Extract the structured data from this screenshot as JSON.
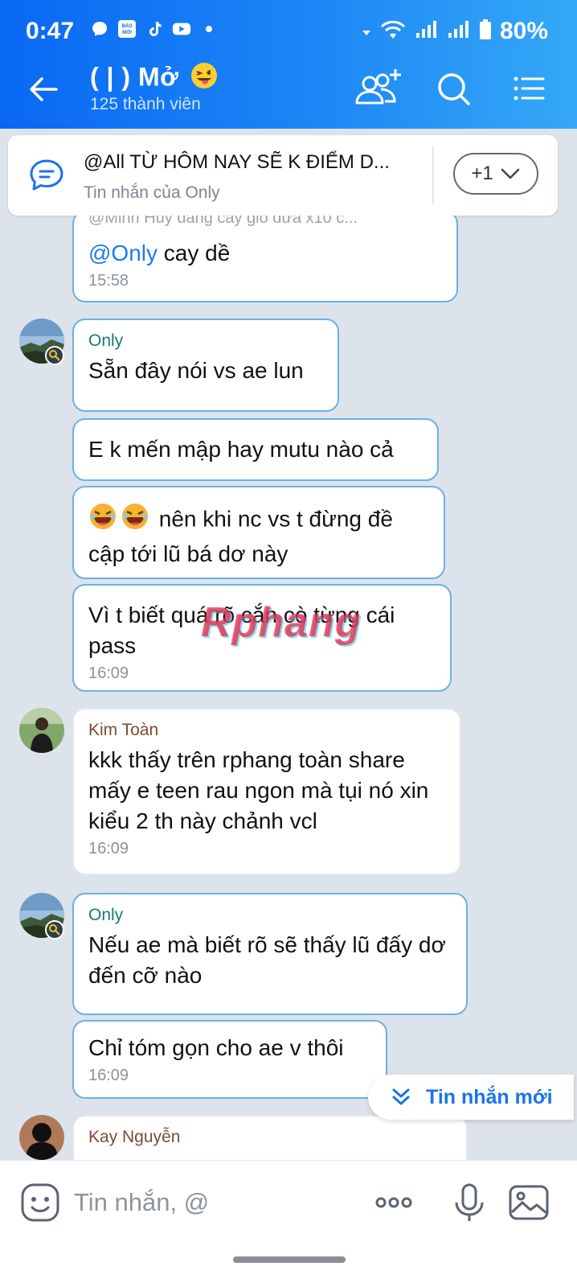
{
  "status_bar": {
    "time": "0:47",
    "battery": "80%"
  },
  "header": {
    "title": "( | ) Mở",
    "subtitle": "125 thành viên"
  },
  "pinned": {
    "title": "@All  TỪ HÔM NAY SẼ K ĐIỂM D...",
    "subtitle": "Tin nhắn của Only",
    "more_label": "+1"
  },
  "messages": {
    "m0": {
      "quote": "@Minh Huy đang cay gió đưa x10 c...",
      "mention": "@Only",
      "text": " cay dề",
      "time": "15:58"
    },
    "m1": {
      "sender": "Only",
      "text": "Sẵn đây nói vs ae lun"
    },
    "m2": {
      "text": "E k mến mập hay mutu nào cả"
    },
    "m3": {
      "text": "nên khi nc vs t đừng đề cập tới lũ bá dơ này"
    },
    "m4": {
      "text": "Vì t biết quá rõ cắn cò từng cái pass",
      "time": "16:09"
    },
    "m5": {
      "sender": "Kim Toàn",
      "text": "kkk thấy trên rphang toàn share mấy e teen rau ngon mà tụi nó xin kiểu 2 th này chảnh vcl",
      "time": "16:09"
    },
    "m6": {
      "sender": "Only",
      "text": "Nếu ae mà biết rõ sẽ thấy lũ đấy dơ đến cỡ nào"
    },
    "m7": {
      "text": "Chỉ tóm gọn cho ae v thôi",
      "time": "16:09"
    },
    "m8": {
      "sender": "Kay Nguyễn"
    }
  },
  "new_message_label": "Tin nhắn mới",
  "input": {
    "placeholder": "Tin nhắn, @"
  },
  "watermark": "Rphang",
  "colors": {
    "header_start": "#0a68f3",
    "header_end": "#35a8f7",
    "bubble_border": "#6cb0e6",
    "chat_bg": "#dde3ea"
  }
}
